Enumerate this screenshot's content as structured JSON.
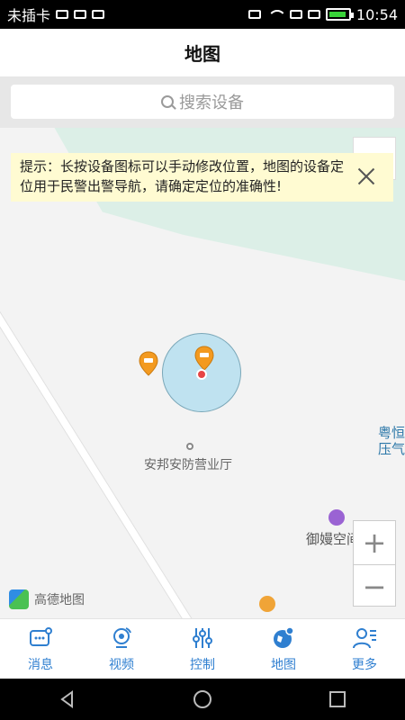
{
  "status_bar": {
    "carrier": "未插卡",
    "time": "10:54"
  },
  "header": {
    "title": "地图"
  },
  "search": {
    "placeholder": "搜索设备"
  },
  "map": {
    "tip_text": "提示：长按设备图标可以手动修改位置，地图的设备定位用于民警出警导航，请确定定位的准确性!",
    "poi_label": "安邦安防营业厅",
    "right_label_1": "粤恒",
    "right_label_2": "压气",
    "shop_label": "御嫚空间",
    "logo_text": "高德地图"
  },
  "tabs": [
    {
      "label": "消息",
      "icon": "message-icon"
    },
    {
      "label": "视频",
      "icon": "camera-icon"
    },
    {
      "label": "控制",
      "icon": "sliders-icon"
    },
    {
      "label": "地图",
      "icon": "map-globe-icon"
    },
    {
      "label": "更多",
      "icon": "user-more-icon"
    }
  ],
  "colors": {
    "accent": "#2f7fd0",
    "tip_bg": "#fffbd2",
    "circle": "#bfe2f0",
    "marker": "#f39a20"
  }
}
